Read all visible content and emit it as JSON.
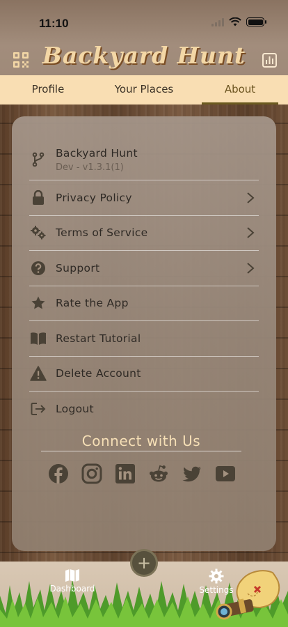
{
  "status": {
    "time": "11:10"
  },
  "app": {
    "title": "Backyard Hunt"
  },
  "tabs": [
    {
      "label": "Profile"
    },
    {
      "label": "Your Places"
    },
    {
      "label": "About"
    }
  ],
  "menu": {
    "app_info": {
      "label": "Backyard Hunt",
      "version": "Dev - v1.3.1(1)"
    },
    "items": [
      {
        "label": "Privacy Policy",
        "icon": "lock-icon"
      },
      {
        "label": "Terms of Service",
        "icon": "gears-icon"
      },
      {
        "label": "Support",
        "icon": "question-circle-icon"
      },
      {
        "label": "Rate the App",
        "icon": "star-icon"
      },
      {
        "label": "Restart Tutorial",
        "icon": "book-icon"
      },
      {
        "label": "Delete Account",
        "icon": "warning-icon"
      },
      {
        "label": "Logout",
        "icon": "logout-icon"
      }
    ]
  },
  "connect": {
    "title": "Connect with Us",
    "socials": [
      "facebook-icon",
      "instagram-icon",
      "linkedin-icon",
      "reddit-icon",
      "twitter-icon",
      "youtube-icon"
    ]
  },
  "bottom_nav": {
    "dashboard": "Dashboard",
    "settings": "Settings",
    "fab": "+"
  },
  "colors": {
    "tab_bar": "#f9deb3",
    "title": "#f3d7a6",
    "icon": "#4a4236",
    "accent_underline": "#6b5a1f"
  }
}
